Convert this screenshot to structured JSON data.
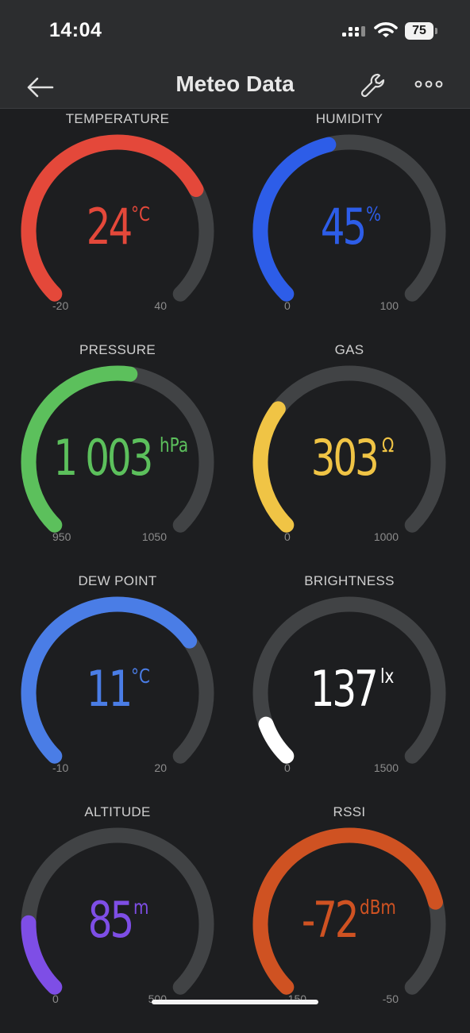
{
  "status": {
    "time": "14:04",
    "battery": "75"
  },
  "appbar": {
    "title": "Meteo Data",
    "icons": [
      "back-arrow-icon",
      "wrench-icon",
      "more-icon"
    ]
  },
  "colors": {
    "track": "#414345",
    "background": "#1d1e20",
    "bar": "#2c2d2f"
  },
  "gauges": [
    {
      "label": "TEMPERATURE",
      "value": "24",
      "unit": "°C",
      "min": "-20",
      "max": "40",
      "fraction": 0.73,
      "color": "#e4483a"
    },
    {
      "label": "HUMIDITY",
      "value": "45",
      "unit": "%",
      "min": "0",
      "max": "100",
      "fraction": 0.45,
      "color": "#2d5de8"
    },
    {
      "label": "PRESSURE",
      "value": "1 003",
      "unit": "hPa",
      "min": "950",
      "max": "1050",
      "fraction": 0.53,
      "color": "#5cc05c"
    },
    {
      "label": "GAS",
      "value": "303",
      "unit": "Ω",
      "min": "0",
      "max": "1000",
      "fraction": 0.303,
      "color": "#f0c445"
    },
    {
      "label": "DEW POINT",
      "value": "11",
      "unit": "°C",
      "min": "-10",
      "max": "20",
      "fraction": 0.7,
      "color": "#4a7de6"
    },
    {
      "label": "BRIGHTNESS",
      "value": "137",
      "unit": "lx",
      "min": "0",
      "max": "1500",
      "fraction": 0.091,
      "color": "#ffffff"
    },
    {
      "label": "ALTITUDE",
      "value": "85",
      "unit": "m",
      "min": "0",
      "max": "500",
      "fraction": 0.17,
      "color": "#7e4ee6"
    },
    {
      "label": "RSSI",
      "value": "-72",
      "unit": "dBm",
      "min": "-150",
      "max": "-50",
      "fraction": 0.78,
      "color": "#cf5222"
    }
  ]
}
